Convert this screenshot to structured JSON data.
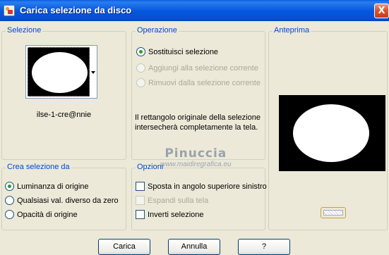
{
  "window": {
    "title": "Carica selezione da disco",
    "close_glyph": "X"
  },
  "selezione": {
    "title": "Selezione",
    "file_name": "ilse-1-cre@nnie"
  },
  "operazione": {
    "title": "Operazione",
    "options": [
      {
        "label": "Sostituisci selezione",
        "selected": true,
        "enabled": true
      },
      {
        "label": "Aggiungi alla selezione corrente",
        "selected": false,
        "enabled": false
      },
      {
        "label": "Rimuovi dalla selezione corrente",
        "selected": false,
        "enabled": false
      }
    ],
    "description_line1": "Il rettangolo originale della selezione",
    "description_line2": "intersecherà completamente la tela."
  },
  "anteprima": {
    "title": "Anteprima"
  },
  "crea_selezione": {
    "title": "Crea selezione da",
    "options": [
      {
        "label": "Luminanza di origine",
        "selected": true
      },
      {
        "label": "Qualsiasi val. diverso da zero",
        "selected": false
      },
      {
        "label": "Opacità di origine",
        "selected": false
      }
    ]
  },
  "opzioni": {
    "title": "Opzioni",
    "checks": [
      {
        "label": "Sposta in angolo superiore sinistro",
        "checked": false,
        "enabled": true
      },
      {
        "label": "Espandi sulla tela",
        "checked": false,
        "enabled": false
      },
      {
        "label": "Inverti selezione",
        "checked": false,
        "enabled": true
      }
    ]
  },
  "watermark": {
    "name": "Pinuccia",
    "url": "www.maidiregrafica.eu"
  },
  "buttons": {
    "carica": "Carica",
    "annulla": "Annulla",
    "help": "?"
  }
}
